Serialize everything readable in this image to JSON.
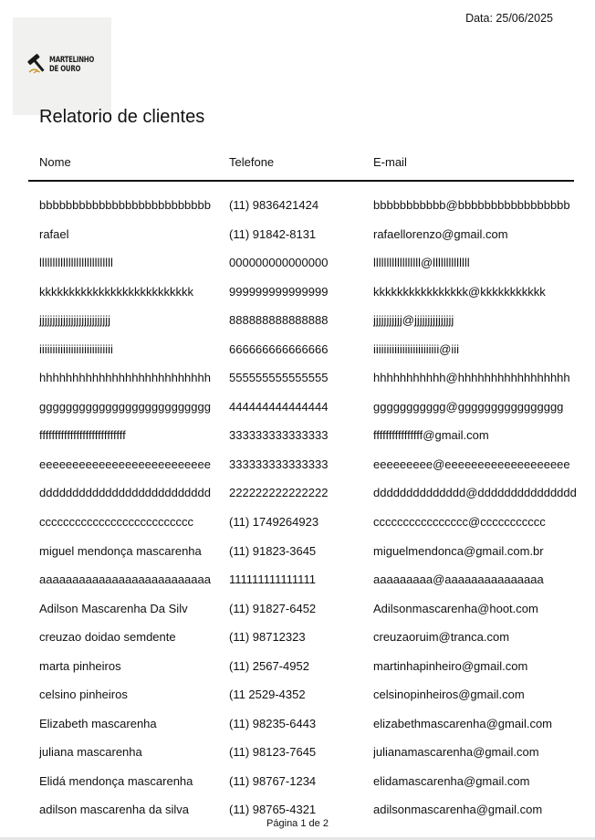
{
  "date_text": "Data: 25/06/2025",
  "logo": {
    "line1": "MARTELINHO",
    "line2": "DE OURO",
    "accent_color": "#c9962c"
  },
  "title": "Relatorio de clientes",
  "columns": {
    "name": "Nome",
    "phone": "Telefone",
    "email": "E-mail"
  },
  "rows": [
    {
      "name": "bbbbbbbbbbbbbbbbbbbbbbbbbb",
      "phone": "(11) 9836421424",
      "email": "bbbbbbbbbbb@bbbbbbbbbbbbbbbbb"
    },
    {
      "name": "rafael",
      "phone": "(11) 91842-8131",
      "email": "rafaellorenzo@gmail.com"
    },
    {
      "name": "llllllllllllllllllllllllllll",
      "phone": "000000000000000",
      "email": "llllllllllllllllll@llllllllllllll"
    },
    {
      "name": "kkkkkkkkkkkkkkkkkkkkkkkkkk",
      "phone": "999999999999999",
      "email": "kkkkkkkkkkkkkkkk@kkkkkkkkkkk"
    },
    {
      "name": "jjjjjjjjjjjjjjjjjjjjjjjjjjj",
      "phone": "888888888888888",
      "email": "jjjjjjjjjjj@jjjjjjjjjjjjjjj"
    },
    {
      "name": "iiiiiiiiiiiiiiiiiiiiiiiiiiii",
      "phone": "666666666666666",
      "email": "iiiiiiiiiiiiiiiiiiiiiiiii@iii"
    },
    {
      "name": "hhhhhhhhhhhhhhhhhhhhhhhhhh",
      "phone": "555555555555555",
      "email": "hhhhhhhhhhh@hhhhhhhhhhhhhhhhh"
    },
    {
      "name": "gggggggggggggggggggggggggg",
      "phone": "444444444444444",
      "email": "ggggggggggg@gggggggggggggggg"
    },
    {
      "name": "ffffffffffffffffffffffffffff",
      "phone": "333333333333333",
      "email": "ffffffffffffffff@gmail.com"
    },
    {
      "name": "eeeeeeeeeeeeeeeeeeeeeeeeee",
      "phone": "333333333333333",
      "email": "eeeeeeeee@eeeeeeeeeeeeeeeeeee"
    },
    {
      "name": "dddddddddddddddddddddddddd",
      "phone": "222222222222222",
      "email": "dddddddddddddd@ddddddddddddddd"
    },
    {
      "name": "cccccccccccccccccccccccccc",
      "phone": "(11) 1749264923",
      "email": "cccccccccccccccc@ccccccccccc"
    },
    {
      "name": "miguel mendonça mascarenha",
      "phone": "(11) 91823-3645",
      "email": "miguelmendonca@gmail.com.br"
    },
    {
      "name": "aaaaaaaaaaaaaaaaaaaaaaaaaa",
      "phone": "111111111111111",
      "email": "aaaaaaaaa@aaaaaaaaaaaaaaa"
    },
    {
      "name": "Adilson Mascarenha Da Silv",
      "phone": "(11) 91827-6452",
      "email": "Adilsonmascarenha@hoot.com"
    },
    {
      "name": "creuzao doidao semdente",
      "phone": "(11) 98712323",
      "email": "creuzaoruim@tranca.com"
    },
    {
      "name": "marta pinheiros",
      "phone": "(11) 2567-4952",
      "email": "martinhapinheiro@gmail.com"
    },
    {
      "name": "celsino pinheiros",
      "phone": "(11 2529-4352",
      "email": "celsinopinheiros@gmail.com"
    },
    {
      "name": "Elizabeth mascarenha",
      "phone": "(11) 98235-6443",
      "email": "elizabethmascarenha@gmail.com"
    },
    {
      "name": "juliana mascarenha",
      "phone": "(11) 98123-7645",
      "email": "julianamascarenha@gmail.com"
    },
    {
      "name": "Elidá mendonça mascarenha",
      "phone": "(11) 98767-1234",
      "email": "elidamascarenha@gmail.com"
    },
    {
      "name": "adilson mascarenha da silva",
      "phone": "(11) 98765-4321",
      "email": "adilsonmascarenha@gmail.com"
    }
  ],
  "footer": "Página 1 de 2"
}
